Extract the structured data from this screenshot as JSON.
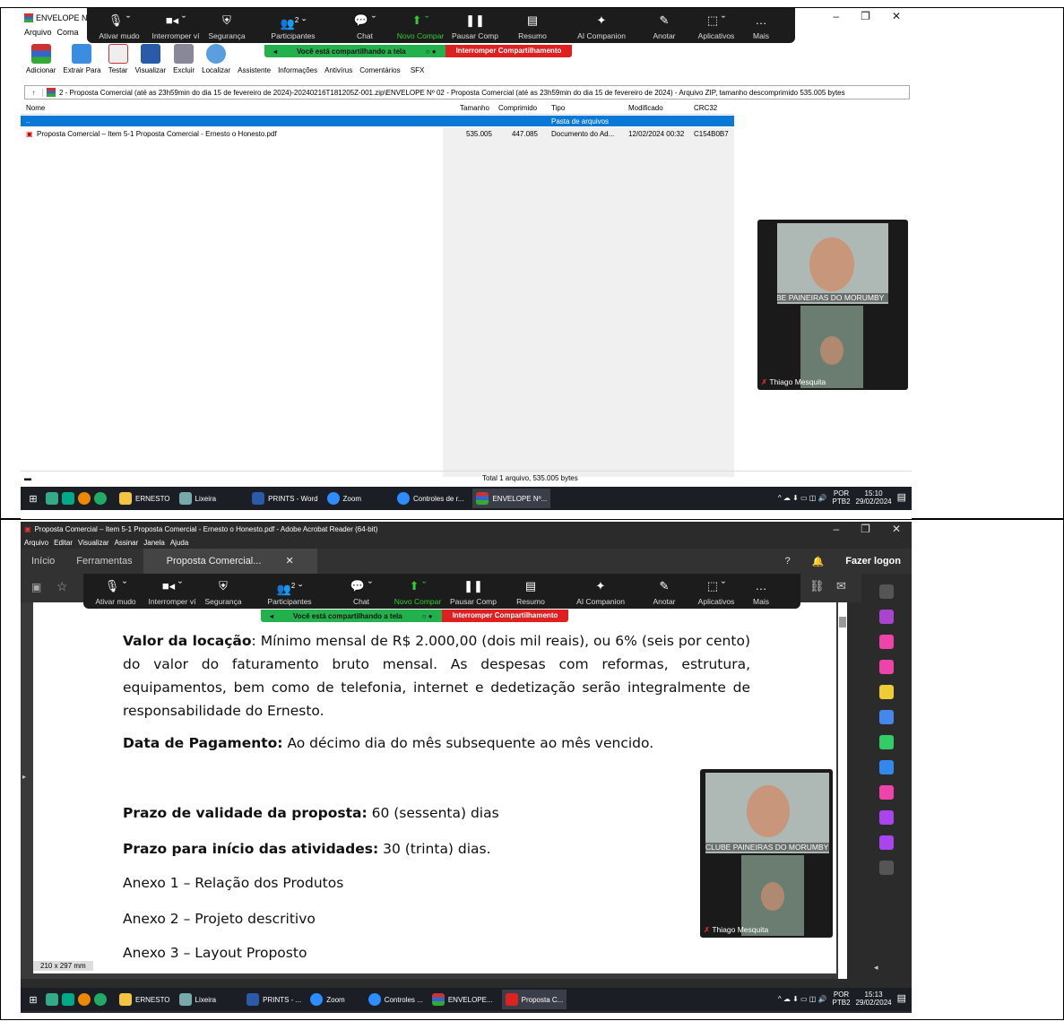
{
  "top": {
    "title": "ENVELOPE Nº",
    "menu": [
      "Arquivo",
      "Coma"
    ],
    "toolbar": [
      "Adicionar",
      "Extrair Para",
      "Testar",
      "Visualizar",
      "Excluir",
      "Localizar",
      "Assistente",
      "Informações",
      "Antivírus",
      "Comentários",
      "SFX"
    ],
    "address": "2 - Proposta Comercial (até as 23h59min do dia 15 de fevereiro de 2024)-20240216T181205Z-001.zip\\ENVELOPE Nº 02 - Proposta Comercial (até as 23h59min do dia 15 de fevereiro de 2024) - Arquivo ZIP, tamanho descomprimido 535.005 bytes",
    "columns": [
      "Nome",
      "Tamanho",
      "Comprimido",
      "Tipo",
      "Modificado",
      "CRC32"
    ],
    "row_parent": {
      "name": "..",
      "type": "Pasta de arquivos"
    },
    "row_file": {
      "name": "Proposta Comercial – Item 5-1 Proposta Comercial - Ernesto o Honesto.pdf",
      "size": "535.005",
      "packed": "447.085",
      "type": "Documento do Ad...",
      "modified": "12/02/2024 00:32",
      "crc": "C154B0B7"
    },
    "status": "Total 1 arquivo, 535.005 bytes",
    "taskbar": [
      "ERNESTO",
      "Lixeira",
      "PRINTS - Word",
      "Zoom",
      "Controles de r...",
      "ENVELOPE Nº..."
    ],
    "tray": {
      "lang": "POR",
      "kb": "PTB2",
      "time": "15:10",
      "date": "29/02/2024"
    }
  },
  "zoom": {
    "items": [
      "Ativar mudo",
      "Interromper ví",
      "Segurança",
      "Participantes",
      "Chat",
      "Novo Compar",
      "Pausar Comp",
      "Resumo",
      "AI Companion",
      "Anotar",
      "Aplicativos",
      "Mais"
    ],
    "items2": [
      "Ativar mudo",
      "Interromper ví",
      "Segurança",
      "Participantes",
      "Chat",
      "Novo Compar",
      "Pausar Comp",
      "Resumo",
      "AI Companion",
      "Anotar",
      "Aplicativos",
      "Mais"
    ],
    "participants_count": "2",
    "sharing": "Você está compartilhando a tela",
    "stop": "Interromper Compartilhamento",
    "video1": "CLUBE PAINEIRAS DO MORUMBY",
    "video2": "Thiago Mesquita"
  },
  "bottom": {
    "title": "Proposta Comercial – Item 5-1 Proposta Comercial - Ernesto o Honesto.pdf - Adobe Acrobat Reader (64-bit)",
    "menu": [
      "Arquivo",
      "Editar",
      "Visualizar",
      "Assinar",
      "Janela",
      "Ajuda"
    ],
    "tabs": [
      "Início",
      "Ferramentas",
      "Proposta Comercial..."
    ],
    "login": "Fazer logon",
    "pagesize": "210 x 297 mm",
    "p1_bold": "Valor da locação",
    "p1": ": Mínimo mensal de R$ 2.000,00 (dois mil reais), ou 6% (seis por cento) do valor do faturamento bruto mensal. As despesas com reformas, estrutura, equipamentos, bem como de telefonia, internet e dedetização serão integralmente de responsabilidade do Ernesto.",
    "p2_bold": "Data de Pagamento:",
    "p2": " Ao décimo dia do mês subsequente ao mês vencido.",
    "p3_bold": "Prazo de validade da proposta:",
    "p3": " 60 (sessenta) dias",
    "p4_bold": "Prazo para início das atividades:",
    "p4": " 30 (trinta) dias.",
    "p5": "Anexo 1 – Relação dos Produtos",
    "p6": "Anexo 2 – Projeto descritivo",
    "p7": "Anexo 3 – Layout Proposto",
    "taskbar": [
      "ERNESTO",
      "Lixeira",
      "PRINTS - ...",
      "Zoom",
      "Controles ...",
      "ENVELOPE...",
      "Proposta C..."
    ],
    "tray": {
      "lang": "POR",
      "kb": "PTB2",
      "time": "15:13",
      "date": "29/02/2024"
    }
  }
}
